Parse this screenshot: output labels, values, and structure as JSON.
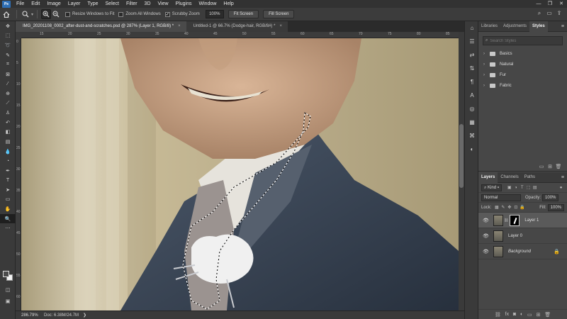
{
  "menubar": {
    "logo": "Ps",
    "items": [
      "File",
      "Edit",
      "Image",
      "Layer",
      "Type",
      "Select",
      "Filter",
      "3D",
      "View",
      "Plugins",
      "Window",
      "Help"
    ],
    "controls": [
      "—",
      "❐",
      "✕"
    ]
  },
  "options": {
    "resize_windows_label": "Resize Windows to Fit",
    "zoom_all_label": "Zoom All Windows",
    "scrubby_zoom_label": "Scrubby Zoom",
    "scrubby_checked": "✓",
    "zoom_value": "100%",
    "fit_screen_label": "Fit Screen",
    "fill_screen_label": "Fill Screen"
  },
  "tabs": [
    {
      "label": "IMG_20201108_0002_after-dust-and-scratches.psd @ 287% (Layer 1, RGB/8) *",
      "close": "×"
    },
    {
      "label": "Untitled-1 @ 66.7% (Dodge-hair, RGB/8#) *",
      "close": "×"
    }
  ],
  "ruler": {
    "h_ticks": [
      "15",
      "20",
      "25",
      "30",
      "35",
      "40",
      "45",
      "50",
      "55",
      "60",
      "65",
      "70",
      "75",
      "80",
      "85"
    ],
    "v_ticks": [
      "0",
      "5",
      "10",
      "15",
      "20",
      "25",
      "30",
      "35",
      "40",
      "45",
      "50",
      "55",
      "60"
    ]
  },
  "status": {
    "zoom": "286.79%",
    "doc": "Doc: 6.38M/24.7M",
    "arrow": "❯"
  },
  "panel_top": {
    "tabs": [
      "Libraries",
      "Adjustments",
      "Styles"
    ],
    "active_tab": "Styles",
    "search_placeholder": "Search Styles",
    "groups": [
      "Basics",
      "Natural",
      "Fur",
      "Fabric"
    ]
  },
  "layers_panel": {
    "tabs": [
      "Layers",
      "Channels",
      "Paths"
    ],
    "kind_label": "Kind",
    "blend_mode": "Normal",
    "opacity_label": "Opacity:",
    "opacity_value": "100%",
    "lock_label": "Lock:",
    "fill_label": "Fill:",
    "fill_value": "100%",
    "layers": [
      {
        "name": "Layer 1",
        "selected": true,
        "has_mask": true
      },
      {
        "name": "Layer 0",
        "selected": false,
        "has_mask": false
      },
      {
        "name": "Background",
        "selected": false,
        "has_mask": false,
        "locked": true
      }
    ]
  }
}
